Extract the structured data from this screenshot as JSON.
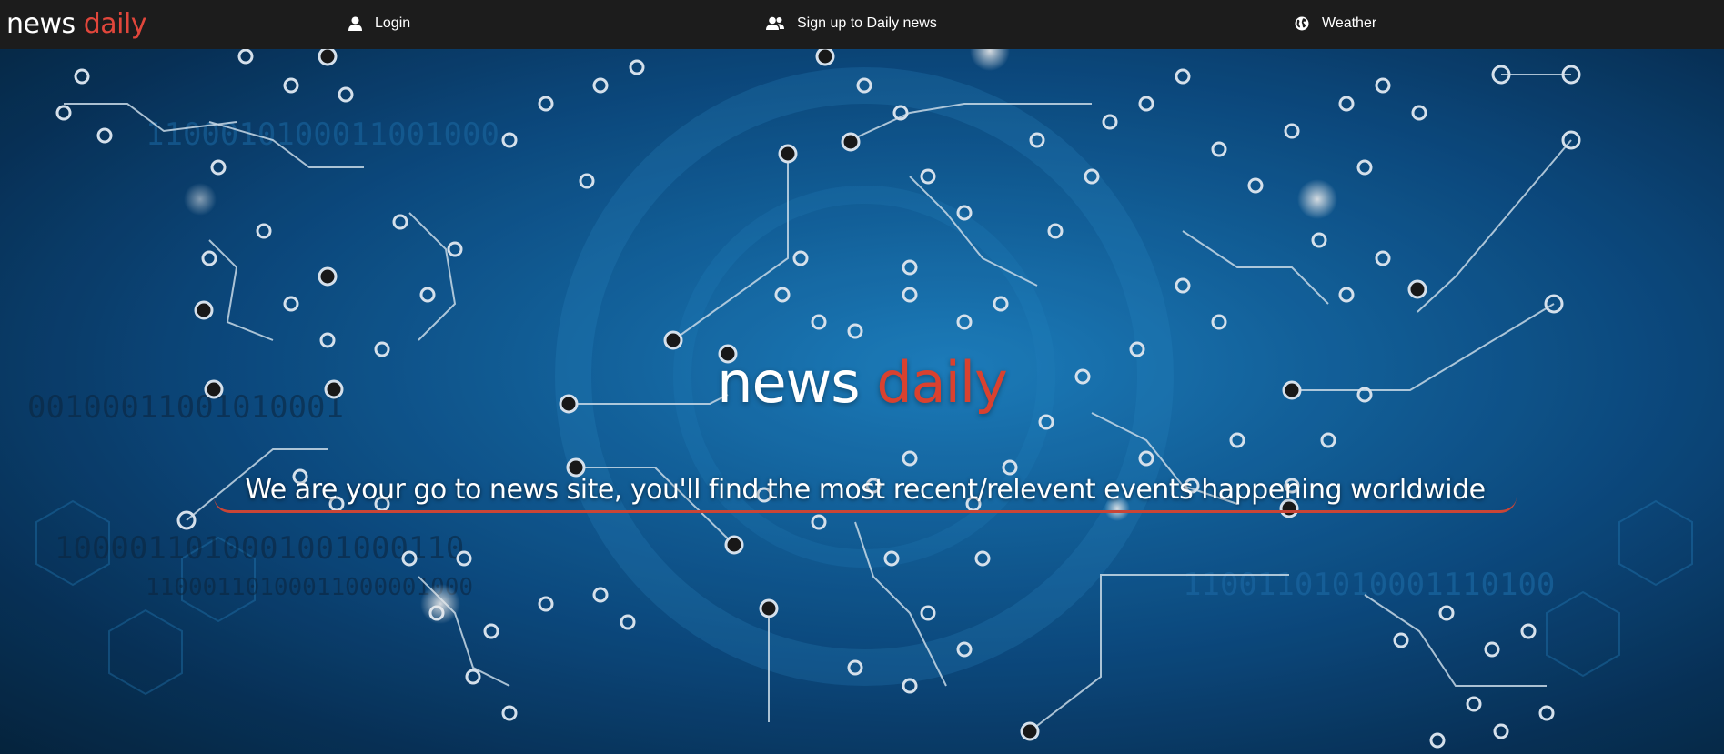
{
  "navbar": {
    "brand_part1": "news",
    "brand_part2": "daily",
    "links": {
      "login": "Login",
      "signup": "Sign up to Daily news",
      "weather": "Weather"
    },
    "icons": {
      "login": "user-icon",
      "signup": "users-icon",
      "weather": "globe-icon"
    }
  },
  "hero": {
    "title_part1": "news",
    "title_part2": "daily",
    "tagline": "We are your go to news site, you'll find the most recent/relevent events happening worldwide",
    "background": "circuit-board-world-map-image"
  },
  "colors": {
    "navbar_bg": "#1c1c1c",
    "accent": "#e0463b",
    "hero_blue": "#1468a6"
  }
}
